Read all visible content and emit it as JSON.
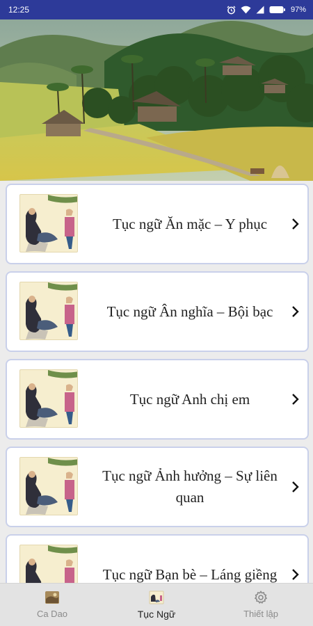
{
  "status_bar": {
    "time": "12:25",
    "battery": "97%"
  },
  "banner": {
    "image": "rural-landscape"
  },
  "items": [
    {
      "label": "Tục ngữ Ăn mặc – Y phục",
      "thumb": "old-woman-thumbnail"
    },
    {
      "label": "Tục ngữ Ân nghĩa – Bội bạc",
      "thumb": "old-woman-thumbnail"
    },
    {
      "label": "Tục ngữ Anh chị em",
      "thumb": "old-woman-thumbnail"
    },
    {
      "label": "Tục ngữ Ảnh hưởng – Sự liên quan",
      "thumb": "old-woman-thumbnail"
    },
    {
      "label": "Tục ngữ Bạn bè – Láng giềng",
      "thumb": "old-woman-thumbnail"
    }
  ],
  "bottom_nav": {
    "tabs": [
      {
        "label": "Ca Dao",
        "icon": "ca-dao-icon",
        "active": false
      },
      {
        "label": "Tục Ngữ",
        "icon": "tuc-ngu-icon",
        "active": true
      },
      {
        "label": "Thiết lập",
        "icon": "settings-gear-icon",
        "active": false
      }
    ]
  },
  "colors": {
    "status_bar": "#2d3a99",
    "card_border": "#c9d0ea",
    "background": "#ececec",
    "nav_background": "#e3e3e3"
  }
}
